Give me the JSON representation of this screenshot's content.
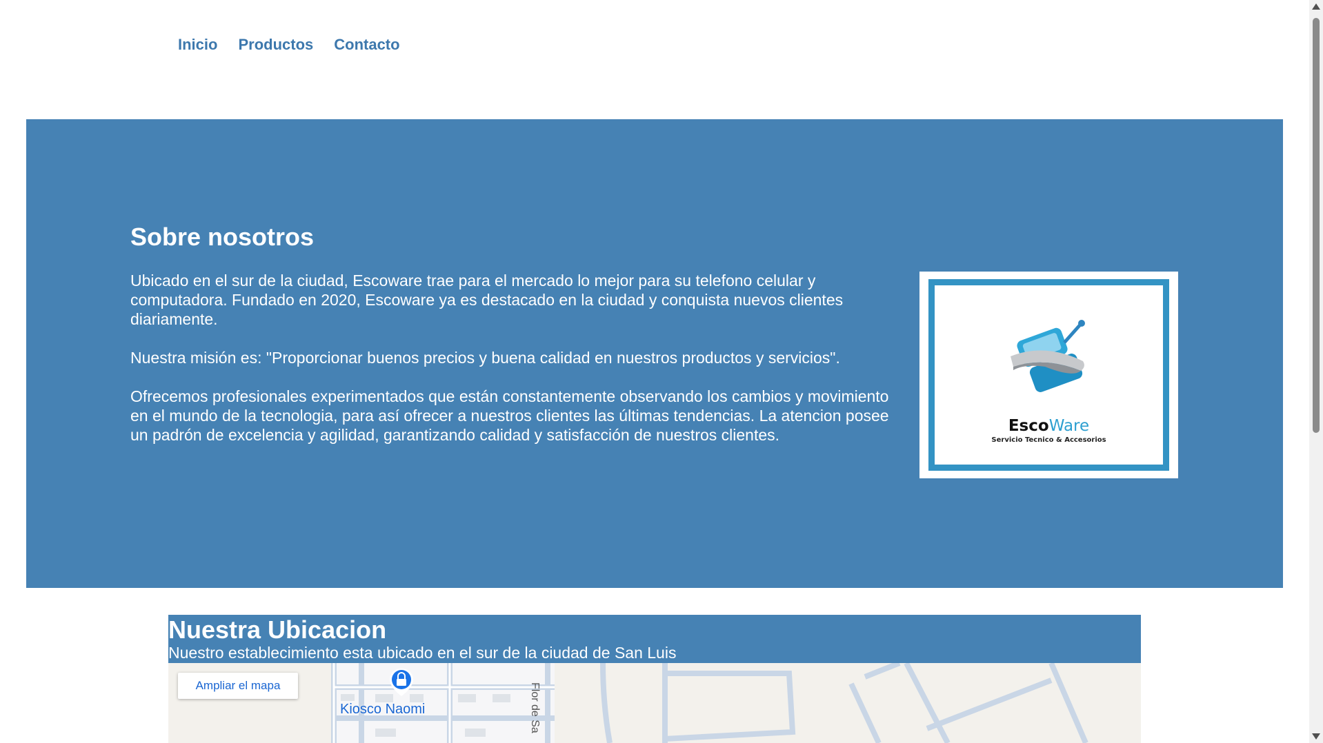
{
  "nav": {
    "items": [
      {
        "label": "Inicio"
      },
      {
        "label": "Productos"
      },
      {
        "label": "Contacto"
      }
    ]
  },
  "about": {
    "title": "Sobre nosotros",
    "paragraphs": [
      "Ubicado en el sur de la ciudad, Escoware trae para el mercado lo mejor para su telefono celular y computadora. Fundado en 2020, Escoware ya es destacado en la ciudad y conquista nuevos clientes diariamente.",
      "Nuestra misión es: \"Proporcionar buenos precios y buena calidad en nuestros productos y servicios\".",
      "Ofrecemos profesionales experimentados que están constantemente observando los cambios y movimiento en el mundo de la tecnologia, para así ofrecer a nuestros clientes las últimas tendencias. La atencion posee un padrón de excelencia y agilidad, garantizando calidad y satisfacción de nuestros clientes."
    ],
    "logo": {
      "word_bold": "Esco",
      "word_light": "Ware",
      "subtitle": "Servicio Tecnico & Accesorios",
      "icon": "phone-wrench-logo-icon"
    }
  },
  "location": {
    "title": "Nuestra Ubicacion",
    "subtitle": "Nuestro establecimiento esta ubicado en el sur de la ciudad de San Luis",
    "map": {
      "button_label": "Ampliar el mapa",
      "place_label": "Kiosco Naomi",
      "street_label": "Flor de Sa",
      "pin_icon": "lock-pin-icon"
    }
  },
  "colors": {
    "nav_link": "#3d78ad",
    "section_bg": "#4682b4",
    "logo_border": "#3393c4",
    "map_link": "#1a66d2"
  }
}
